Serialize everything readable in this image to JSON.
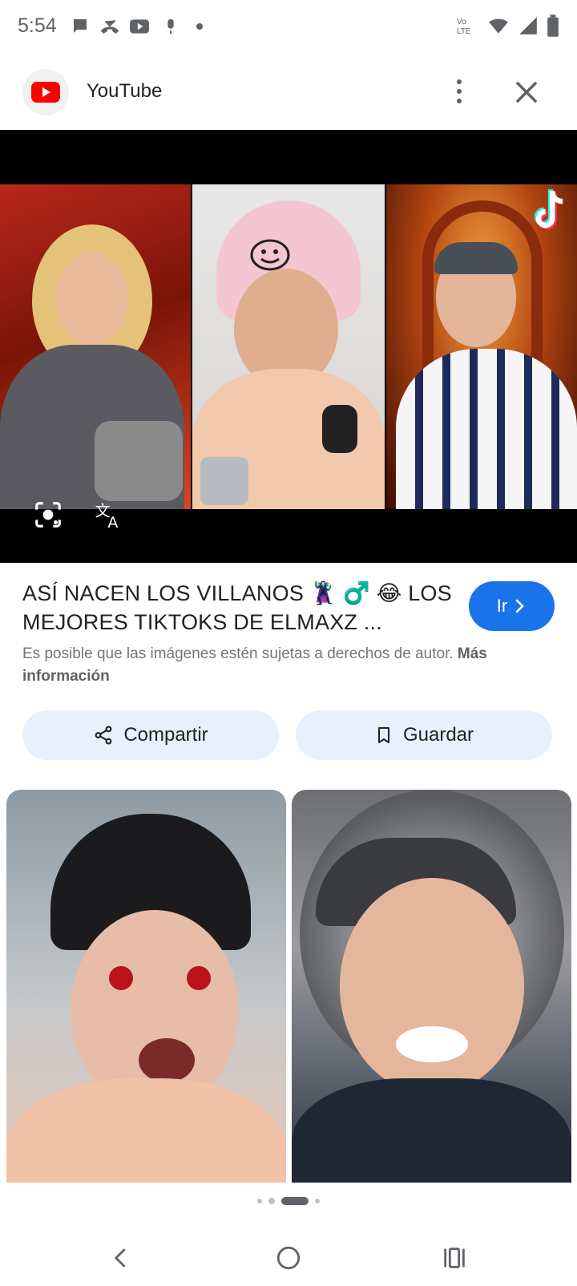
{
  "status_bar": {
    "time": "5:54",
    "left_icons": [
      "chat-bubble-icon",
      "missed-call-icon",
      "youtube-icon",
      "mic-icon",
      "dot-icon"
    ],
    "right_icons": [
      "volte-icon",
      "wifi-icon",
      "signal-icon",
      "battery-icon"
    ],
    "volte_text": "Vo LTE"
  },
  "header": {
    "title": "YouTube",
    "logo": "youtube-logo-icon"
  },
  "viewer": {
    "actions": [
      "lens-icon",
      "translate-icon"
    ]
  },
  "result": {
    "title": "ASÍ NACEN LOS VILLANOS 🦹 ♂️ 😂 LOS MEJORES TIKTOKS DE ELMAXZ ...",
    "go_label": "Ir",
    "copyright_text": "Es posible que las imágenes estén sujetas a derechos de autor.",
    "more_info_label": "Más información"
  },
  "actions": {
    "share_label": "Compartir",
    "save_label": "Guardar"
  },
  "pager": {
    "count": 4,
    "active_index": 2
  },
  "colors": {
    "accent": "#1a73e8",
    "pill_bg": "#e8f0fe",
    "youtube_red": "#ff0000"
  }
}
